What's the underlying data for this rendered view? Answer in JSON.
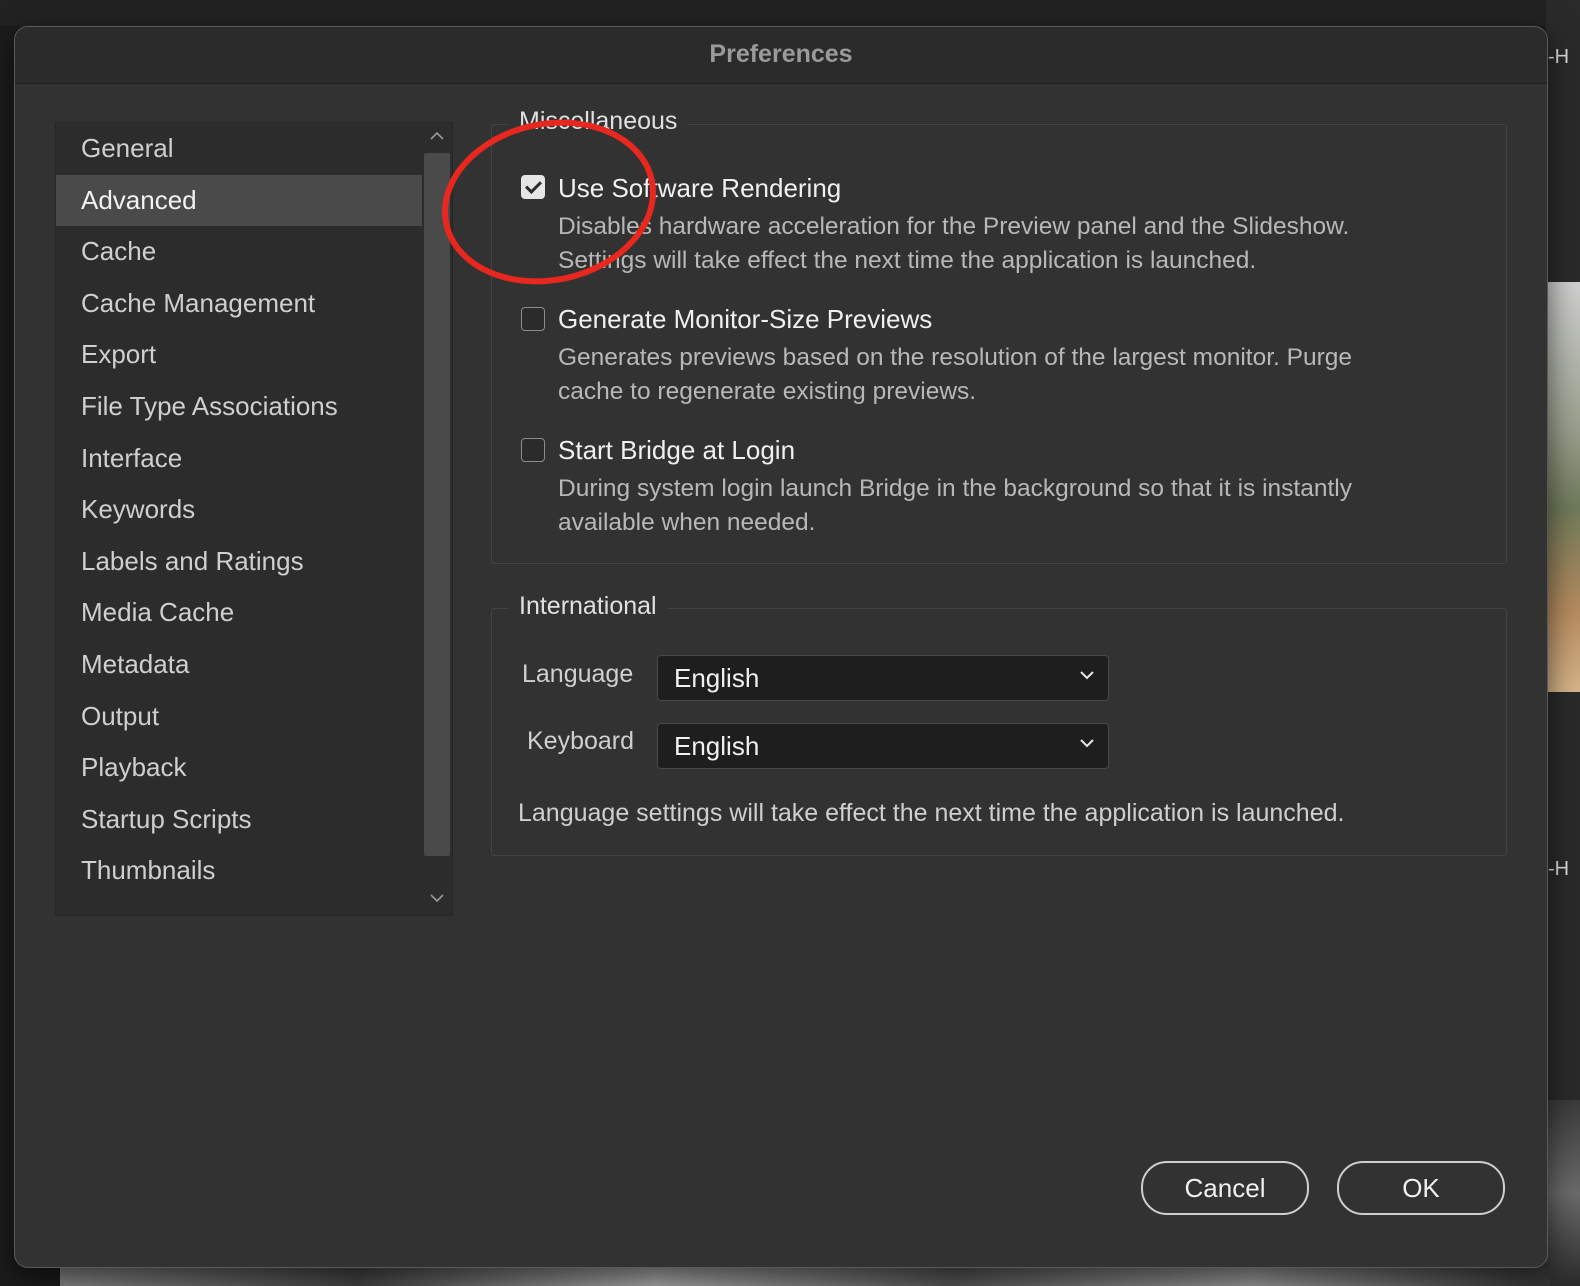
{
  "window": {
    "title": "Preferences"
  },
  "sidebar": {
    "items": [
      {
        "label": "General"
      },
      {
        "label": "Advanced"
      },
      {
        "label": "Cache"
      },
      {
        "label": "Cache Management"
      },
      {
        "label": "Export"
      },
      {
        "label": "File Type Associations"
      },
      {
        "label": "Interface"
      },
      {
        "label": "Keywords"
      },
      {
        "label": "Labels and Ratings"
      },
      {
        "label": "Media Cache"
      },
      {
        "label": "Metadata"
      },
      {
        "label": "Output"
      },
      {
        "label": "Playback"
      },
      {
        "label": "Startup Scripts"
      },
      {
        "label": "Thumbnails"
      }
    ],
    "selected": "Advanced"
  },
  "miscellaneous": {
    "title": "Miscellaneous",
    "options": [
      {
        "label": "Use Software Rendering",
        "checked": true,
        "description_line1": "Disables hardware acceleration for the Preview panel and the Slideshow.",
        "description_line2": "Settings will take effect the next time the application is launched."
      },
      {
        "label": "Generate Monitor-Size Previews",
        "checked": false,
        "description_line1": "Generates previews based on the resolution of the largest monitor.  Purge",
        "description_line2": "cache to regenerate existing previews."
      },
      {
        "label": "Start Bridge at Login",
        "checked": false,
        "description_line1": "During system login launch Bridge in the background so that it is instantly",
        "description_line2": "available when needed."
      }
    ]
  },
  "international": {
    "title": "International",
    "language_label": "Language",
    "language_value": "English",
    "keyboard_label": "Keyboard",
    "keyboard_value": "English",
    "note": "Language settings will take effect the next time the application is launched."
  },
  "buttons": {
    "cancel": "Cancel",
    "ok": "OK"
  },
  "background": {
    "right_tag": "-H"
  },
  "colors": {
    "annotation": "#e8281e",
    "dialog_bg": "#323232",
    "selected_item": "#4a4a4a"
  }
}
